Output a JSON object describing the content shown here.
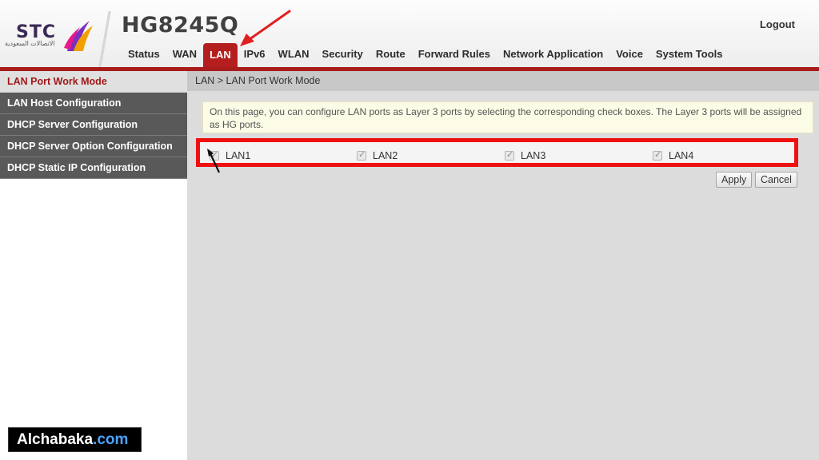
{
  "header": {
    "logo_text": "STC",
    "logo_arabic": "الاتصالات السعودية",
    "model": "HG8245Q",
    "logout_label": "Logout"
  },
  "nav": {
    "tabs": [
      {
        "label": "Status"
      },
      {
        "label": "WAN"
      },
      {
        "label": "LAN",
        "active": true
      },
      {
        "label": "IPv6"
      },
      {
        "label": "WLAN"
      },
      {
        "label": "Security"
      },
      {
        "label": "Route"
      },
      {
        "label": "Forward Rules"
      },
      {
        "label": "Network Application"
      },
      {
        "label": "Voice"
      },
      {
        "label": "System Tools"
      }
    ]
  },
  "sidebar": {
    "items": [
      {
        "label": "LAN Port Work Mode",
        "active": true
      },
      {
        "label": "LAN Host Configuration"
      },
      {
        "label": "DHCP Server Configuration"
      },
      {
        "label": "DHCP Server Option Configuration"
      },
      {
        "label": "DHCP Static IP Configuration"
      }
    ]
  },
  "main": {
    "breadcrumb": "LAN > LAN Port Work Mode",
    "notice": "On this page, you can configure LAN ports as Layer 3 ports by selecting the corresponding check boxes. The Layer 3 ports will be assigned as HG ports.",
    "ports": [
      {
        "label": "LAN1",
        "checked": true
      },
      {
        "label": "LAN2",
        "checked": true
      },
      {
        "label": "LAN3",
        "checked": true
      },
      {
        "label": "LAN4",
        "checked": true
      }
    ],
    "apply_label": "Apply",
    "cancel_label": "Cancel"
  },
  "colors": {
    "accent_red": "#b51e1e",
    "highlight_red": "#ee1111",
    "sidebar_dark": "#595959"
  },
  "watermark": {
    "name": "Alchabaka",
    "domain": ".com"
  }
}
